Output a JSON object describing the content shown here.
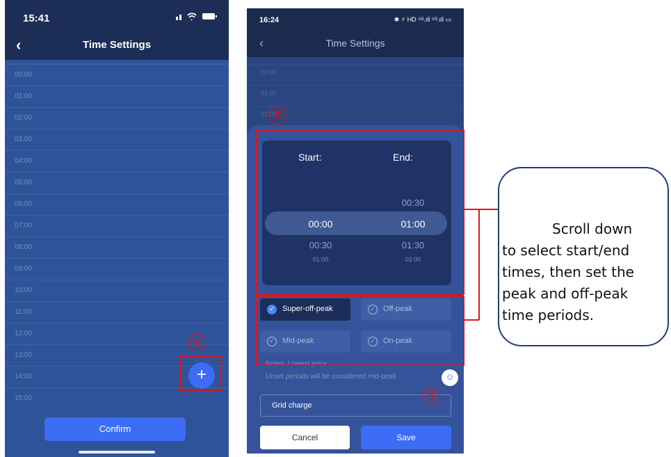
{
  "phone1": {
    "status_time": "15:41",
    "status_icons": "signal-wifi-battery",
    "title": "Time Settings",
    "hours": [
      "00:00",
      "01:00",
      "02:00",
      "03:00",
      "04:00",
      "05:00",
      "06:00",
      "07:00",
      "08:00",
      "09:00",
      "10:00",
      "11:00",
      "12:00",
      "13:00",
      "14:00",
      "15:00"
    ],
    "fab_label": "+",
    "confirm_label": "Confirm"
  },
  "phone2": {
    "status_time": "16:24",
    "status_icons": "✱ ⚡ HD ⁵ᴳ.ıll ⁵ᴳ.ıll ▭",
    "title": "Time Settings",
    "hours": [
      "00:00",
      "01:00",
      "02:00"
    ],
    "picker": {
      "start_label": "Start:",
      "end_label": "End:",
      "end_above": "00:30",
      "start_selected": "00:00",
      "end_selected": "01:00",
      "start_next": "00:30",
      "end_next": "01:30",
      "start_next2": "01:00",
      "end_next2": "02:00"
    },
    "chips": {
      "super_off_peak": "Super-off-peak",
      "off_peak": "Off-peak",
      "mid_peak": "Mid-peak",
      "on_peak": "On-peak"
    },
    "note_1": "Notes: Lowest price",
    "note_2": "Unset periods will be considered mid-peak",
    "grid_charge": "Grid charge",
    "cancel_label": "Cancel",
    "save_label": "Save"
  },
  "annotations": {
    "marker_1": "①",
    "marker_2": "②",
    "marker_3": "③",
    "callout_line1": "Scroll down",
    "callout_line2": "to select start/end",
    "callout_line3": "times, then set the",
    "callout_line4": "peak and off-peak",
    "callout_line5": "time periods.",
    "accent_color": "#e0141b"
  }
}
